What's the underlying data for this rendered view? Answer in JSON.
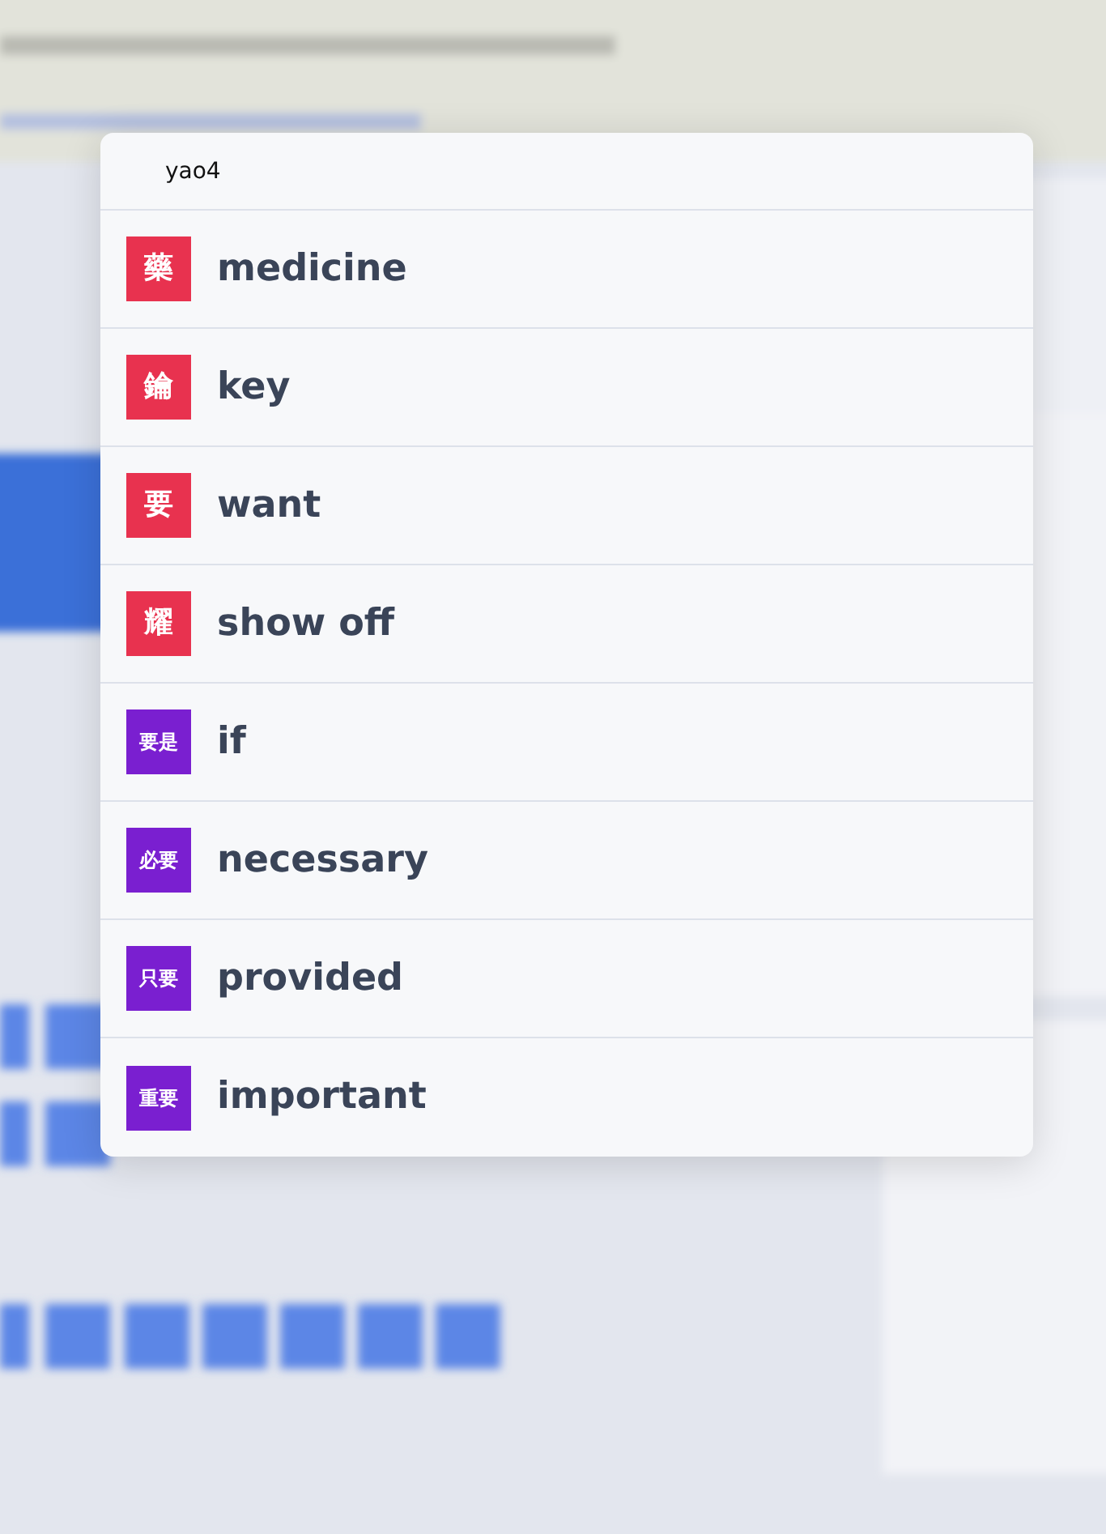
{
  "search": {
    "value": "yao4"
  },
  "results": [
    {
      "glyph": "藥",
      "kind": "character",
      "color": "#e8324f",
      "meaning": "medicine"
    },
    {
      "glyph": "鑰",
      "kind": "character",
      "color": "#e8324f",
      "meaning": "key"
    },
    {
      "glyph": "要",
      "kind": "character",
      "color": "#e8324f",
      "meaning": "want"
    },
    {
      "glyph": "耀",
      "kind": "character",
      "color": "#e8324f",
      "meaning": "show off"
    },
    {
      "glyph": "要是",
      "kind": "word",
      "color": "#7a1fd0",
      "meaning": "if"
    },
    {
      "glyph": "必要",
      "kind": "word",
      "color": "#7a1fd0",
      "meaning": "necessary"
    },
    {
      "glyph": "只要",
      "kind": "word",
      "color": "#7a1fd0",
      "meaning": "provided"
    },
    {
      "glyph": "重要",
      "kind": "word",
      "color": "#7a1fd0",
      "meaning": "important"
    }
  ]
}
